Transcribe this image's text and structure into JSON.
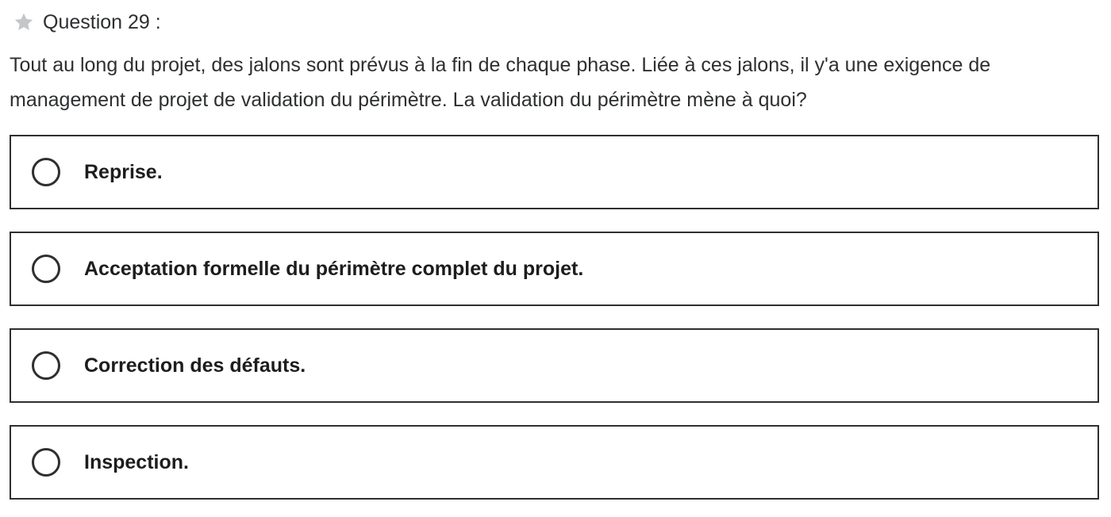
{
  "question": {
    "star_icon": "star-icon",
    "number_label": "Question 29 :",
    "text": "Tout au long du projet, des jalons sont prévus à la fin de chaque phase. Liée à ces jalons, il y'a une exigence de management de projet de validation du périmètre. La validation du périmètre mène à quoi?"
  },
  "options": [
    {
      "label": "Reprise."
    },
    {
      "label": "Acceptation formelle du périmètre complet du projet."
    },
    {
      "label": "Correction des défauts."
    },
    {
      "label": "Inspection."
    }
  ],
  "colors": {
    "text": "#2d2f31",
    "star": "#c4c6c8",
    "border": "#2d2f31"
  }
}
